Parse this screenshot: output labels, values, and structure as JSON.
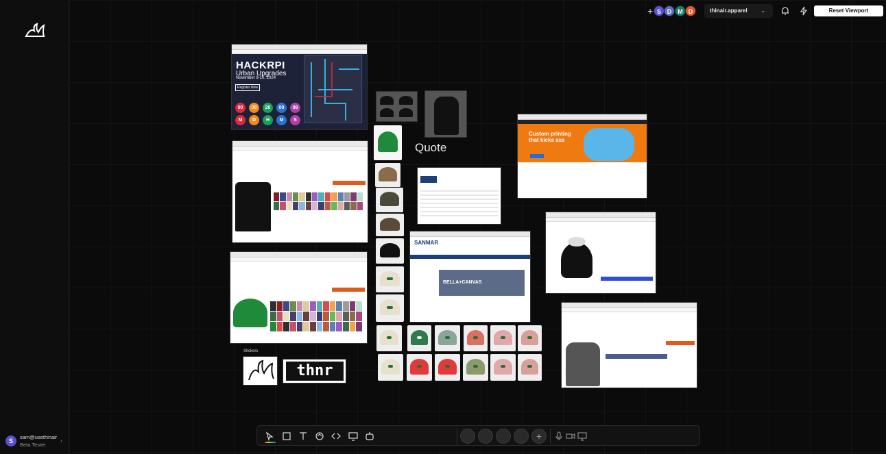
{
  "sidebar": {
    "user": {
      "avatar_initial": "S",
      "email": "sam@usethinair",
      "role": "Beta Tester"
    }
  },
  "topbar": {
    "collaborators": [
      {
        "initial": "S",
        "color": "#5b4fd4"
      },
      {
        "initial": "D",
        "color": "#5a6ec2"
      },
      {
        "initial": "M",
        "color": "#16806b"
      },
      {
        "initial": "D",
        "color": "#e05a2b"
      }
    ],
    "workspace": "thinair.apparel",
    "reset_label": "Reset Viewport"
  },
  "board": {
    "hackrpi": {
      "title": "HACKRPI",
      "subtitle": "Urban Upgrades",
      "date": "November 9-10, 2024",
      "register": "Register Now",
      "countdown": [
        {
          "value": "00",
          "unit": "M",
          "color": "#e0283c"
        },
        {
          "value": "08",
          "unit": "D",
          "color": "#ef8a1a"
        },
        {
          "value": "20",
          "unit": "H",
          "color": "#1aa05a"
        },
        {
          "value": "00",
          "unit": "M",
          "color": "#2c6fd6"
        },
        {
          "value": "08",
          "unit": "S",
          "color": "#b03fa9"
        }
      ]
    },
    "quote_label": "Quote",
    "stickers_label": "Stickers",
    "sticker_text": "thnr",
    "promo": {
      "headline": "Custom printing that kicks ass"
    },
    "sanmar": {
      "brand": "SANMAR",
      "banner": "BELLA+CANVAS"
    }
  }
}
